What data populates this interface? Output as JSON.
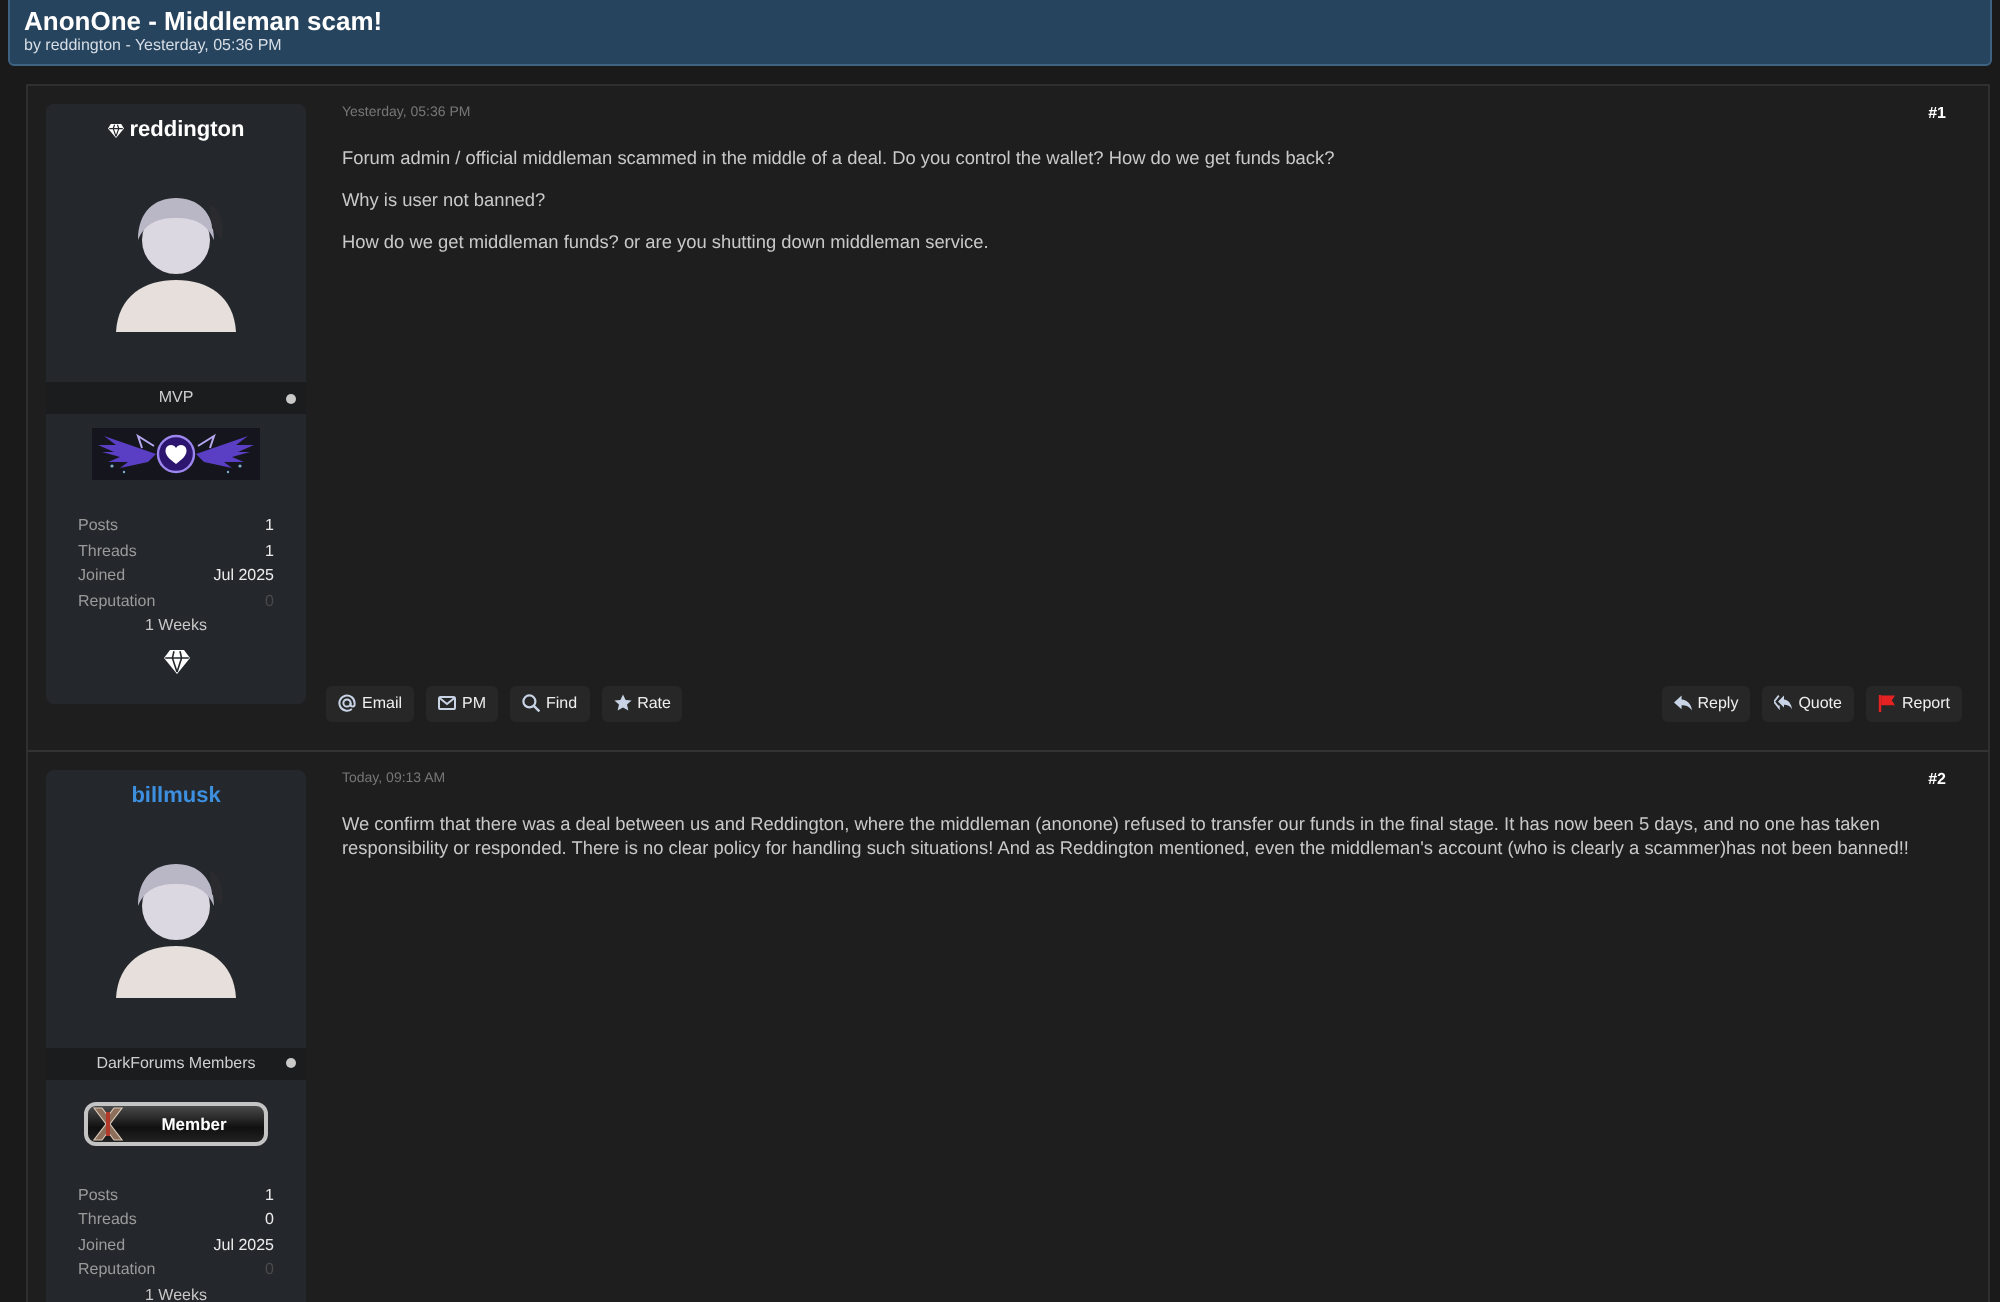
{
  "thread": {
    "title": "AnonOne - Middleman scam!",
    "byline": "by reddington - Yesterday, 05:36 PM"
  },
  "posts": [
    {
      "author": {
        "name": "reddington",
        "color": "#ffffff",
        "gem_icon": true,
        "role": "MVP",
        "badge": {
          "kind": "wings"
        },
        "stats": [
          {
            "label": "Posts",
            "value": "1",
            "muted": false
          },
          {
            "label": "Threads",
            "value": "1",
            "muted": false
          },
          {
            "label": "Joined",
            "value": "Jul 2025",
            "muted": false
          },
          {
            "label": "Reputation",
            "value": "0",
            "muted": true
          }
        ],
        "member_for": "1 Weeks",
        "award_icon": true
      },
      "date": "Yesterday, 05:36 PM",
      "number": "#1",
      "paragraphs": [
        "Forum admin / official middleman scammed in the middle of a deal. Do you control the wallet? How do we get funds back?",
        "Why is user not banned?",
        "How do we get middleman funds? or are you shutting down middleman service."
      ],
      "buttons_left": [
        {
          "label": "Email",
          "kind": "email"
        },
        {
          "label": "PM",
          "kind": "pm"
        },
        {
          "label": "Find",
          "kind": "find"
        },
        {
          "label": "Rate",
          "kind": "rate"
        }
      ],
      "buttons_right": [
        {
          "label": "Reply",
          "kind": "reply"
        },
        {
          "label": "Quote",
          "kind": "quote"
        },
        {
          "label": "Report",
          "kind": "report"
        }
      ]
    },
    {
      "author": {
        "name": "billmusk",
        "color": "#3d8fe0",
        "gem_icon": false,
        "role": "DarkForums Members",
        "badge": {
          "kind": "userbar",
          "label": "Member"
        },
        "stats": [
          {
            "label": "Posts",
            "value": "1",
            "muted": false
          },
          {
            "label": "Threads",
            "value": "0",
            "muted": false
          },
          {
            "label": "Joined",
            "value": "Jul 2025",
            "muted": false
          },
          {
            "label": "Reputation",
            "value": "0",
            "muted": true
          }
        ],
        "member_for": "1 Weeks"
      },
      "date": "Today, 09:13 AM",
      "number": "#2",
      "paragraphs": [
        "We confirm that there was a deal between us and Reddington, where the middleman (anonone) refused to transfer our funds in the final stage. It has now been 5 days, and no one has taken responsibility or responded. There is no clear policy for handling such situations! And as Reddington mentioned, even the middleman's account (who is clearly a scammer)has not been banned!!"
      ]
    }
  ]
}
